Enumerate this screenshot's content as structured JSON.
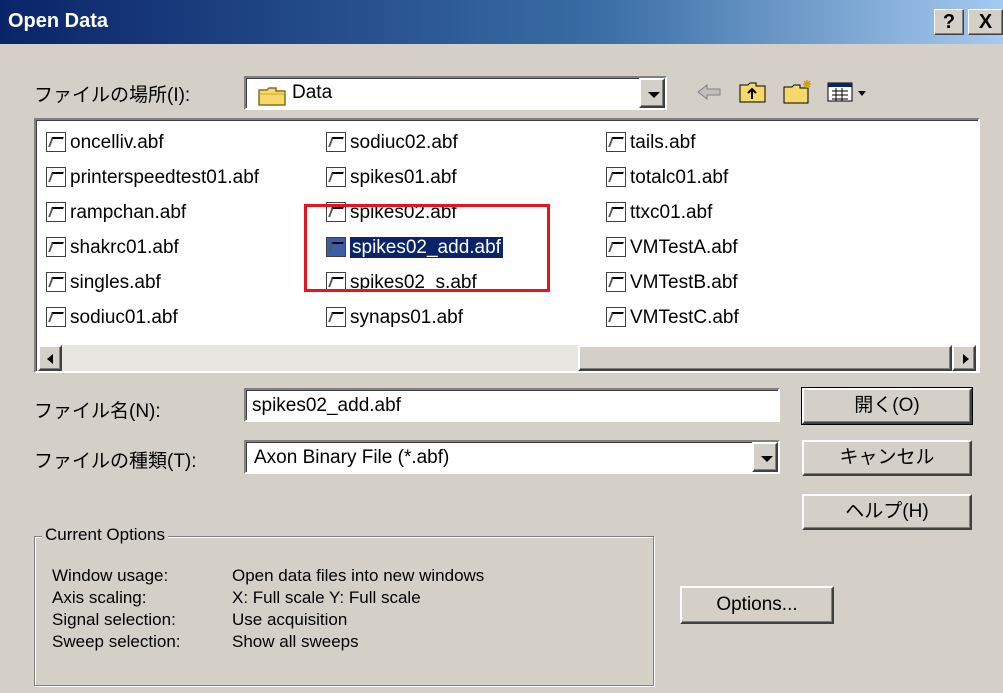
{
  "window": {
    "title": "Open Data",
    "help_btn": "?",
    "close_btn": "X"
  },
  "look_in": {
    "label": "ファイルの場所(I):",
    "value": "Data"
  },
  "toolbar": {
    "back": "back-arrow-icon",
    "up": "up-folder-icon",
    "new_folder": "new-folder-icon",
    "view": "view-menu-icon"
  },
  "files": {
    "col1": [
      "oncelliv.abf",
      "printerspeedtest01.abf",
      "rampchan.abf",
      "shakrc01.abf",
      "singles.abf",
      "sodiuc01.abf"
    ],
    "col2": [
      "sodiuc02.abf",
      "spikes01.abf",
      "spikes02.abf",
      "spikes02_add.abf",
      "spikes02_s.abf",
      "synaps01.abf"
    ],
    "col3": [
      "tails.abf",
      "totalc01.abf",
      "ttxc01.abf",
      "VMTestA.abf",
      "VMTestB.abf",
      "VMTestC.abf"
    ],
    "selected": "spikes02_add.abf"
  },
  "filename": {
    "label": "ファイル名(N):",
    "value": "spikes02_add.abf"
  },
  "filetype": {
    "label": "ファイルの種類(T):",
    "value": "Axon Binary File (*.abf)"
  },
  "buttons": {
    "open": "開く(O)",
    "cancel": "キャンセル",
    "help": "ヘルプ(H)",
    "options": "Options..."
  },
  "current_options": {
    "title": "Current Options",
    "rows": [
      {
        "key": "Window usage:",
        "value": "Open data files into new windows"
      },
      {
        "key": "Axis scaling:",
        "value": "X: Full scale    Y: Full scale"
      },
      {
        "key": "Signal selection:",
        "value": "Use acquisition"
      },
      {
        "key": "Sweep selection:",
        "value": "Show all sweeps"
      }
    ]
  },
  "colors": {
    "highlight_box": "#e8141b",
    "selection": "#0a246a"
  }
}
